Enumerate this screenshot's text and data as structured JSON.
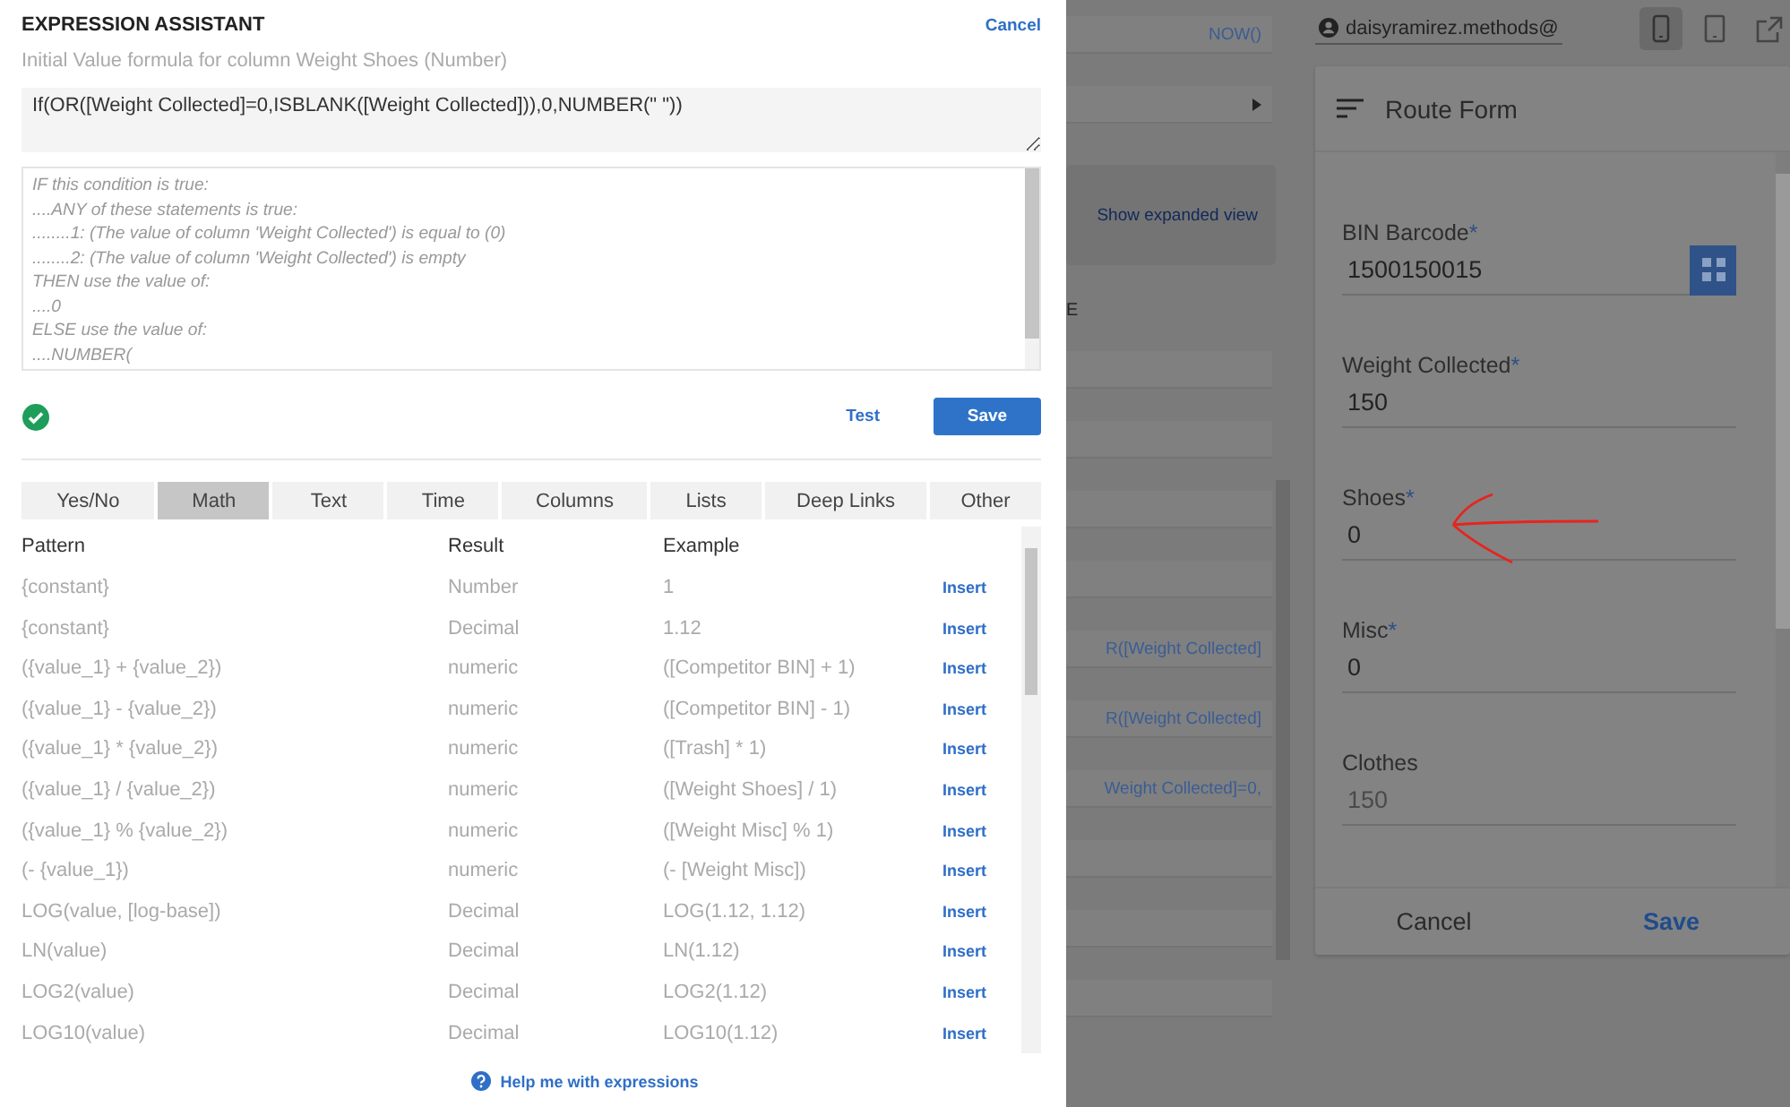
{
  "dialog": {
    "title": "EXPRESSION ASSISTANT",
    "cancel": "Cancel",
    "subtitle": "Initial Value formula for column Weight Shoes (Number)",
    "formula": "If(OR([Weight Collected]=0,ISBLANK([Weight Collected])),0,NUMBER(\" \"))",
    "explanation": [
      "IF this condition is true:",
      "....ANY of these statements is true:",
      "........1: (The value of column 'Weight Collected') is equal to (0)",
      "........2: (The value of column 'Weight Collected') is empty",
      "THEN use the value of:",
      "....0",
      "ELSE use the value of:",
      "....NUMBER("
    ],
    "valid": true,
    "test": "Test",
    "save": "Save",
    "tabs": [
      {
        "label": "Yes/No",
        "selected": false
      },
      {
        "label": "Math",
        "selected": true
      },
      {
        "label": "Text",
        "selected": false
      },
      {
        "label": "Time",
        "selected": false
      },
      {
        "label": "Columns",
        "selected": false
      },
      {
        "label": "Lists",
        "selected": false
      },
      {
        "label": "Deep Links",
        "selected": false
      },
      {
        "label": "Other",
        "selected": false
      }
    ],
    "table": {
      "columns": [
        "Pattern",
        "Result",
        "Example"
      ],
      "rows": [
        {
          "pattern": "{constant}",
          "result": "Number",
          "example": "1",
          "action": "Insert"
        },
        {
          "pattern": "{constant}",
          "result": "Decimal",
          "example": "1.12",
          "action": "Insert"
        },
        {
          "pattern": "({value_1} + {value_2})",
          "result": "numeric",
          "example": "([Competitor BIN] + 1)",
          "action": "Insert"
        },
        {
          "pattern": "({value_1} - {value_2})",
          "result": "numeric",
          "example": "([Competitor BIN] - 1)",
          "action": "Insert"
        },
        {
          "pattern": "({value_1} * {value_2})",
          "result": "numeric",
          "example": "([Trash] * 1)",
          "action": "Insert"
        },
        {
          "pattern": "({value_1} / {value_2})",
          "result": "numeric",
          "example": "([Weight Shoes] / 1)",
          "action": "Insert"
        },
        {
          "pattern": "({value_1} % {value_2})",
          "result": "numeric",
          "example": "([Weight Misc] % 1)",
          "action": "Insert"
        },
        {
          "pattern": "(- {value_1})",
          "result": "numeric",
          "example": "(- [Weight Misc])",
          "action": "Insert"
        },
        {
          "pattern": "LOG(value, [log-base])",
          "result": "Decimal",
          "example": "LOG(1.12, 1.12)",
          "action": "Insert"
        },
        {
          "pattern": "LN(value)",
          "result": "Decimal",
          "example": "LN(1.12)",
          "action": "Insert"
        },
        {
          "pattern": "LOG2(value)",
          "result": "Decimal",
          "example": "LOG2(1.12)",
          "action": "Insert"
        },
        {
          "pattern": "LOG10(value)",
          "result": "Decimal",
          "example": "LOG10(1.12)",
          "action": "Insert"
        }
      ]
    },
    "help": "Help me with expressions"
  },
  "background_editor": {
    "items": [
      {
        "kind": "field",
        "text": "NOW()"
      },
      {
        "kind": "dropdown"
      },
      {
        "kind": "link",
        "text": "Show expanded view"
      },
      {
        "kind": "heading",
        "text": "E"
      },
      {
        "kind": "field"
      },
      {
        "kind": "field"
      },
      {
        "kind": "field"
      },
      {
        "kind": "field"
      },
      {
        "kind": "field",
        "text": "R([Weight Collected]"
      },
      {
        "kind": "field",
        "text": "R([Weight Collected]"
      },
      {
        "kind": "field",
        "text": "Weight Collected]=0,"
      },
      {
        "kind": "field"
      },
      {
        "kind": "field"
      },
      {
        "kind": "field"
      }
    ]
  },
  "preview": {
    "user": "daisyramirez.methods@",
    "devices": [
      {
        "kind": "phone",
        "selected": true
      },
      {
        "kind": "tablet",
        "selected": false
      },
      {
        "kind": "external",
        "selected": false
      }
    ],
    "form": {
      "title": "Route Form",
      "fields": [
        {
          "label": "BIN Barcode",
          "marker": "*",
          "value": "1500150015",
          "kind": "barcode",
          "editable": true
        },
        {
          "label": "Weight Collected",
          "marker": "*",
          "value": "150",
          "kind": "number",
          "editable": true
        },
        {
          "label": "Shoes",
          "marker": "*",
          "value": "0",
          "kind": "number",
          "editable": true
        },
        {
          "label": "Misc",
          "marker": "*",
          "value": "0",
          "kind": "number",
          "editable": true
        },
        {
          "label": "Clothes",
          "value": "150",
          "kind": "number",
          "editable": false
        }
      ],
      "cancel": "Cancel",
      "save": "Save"
    }
  }
}
